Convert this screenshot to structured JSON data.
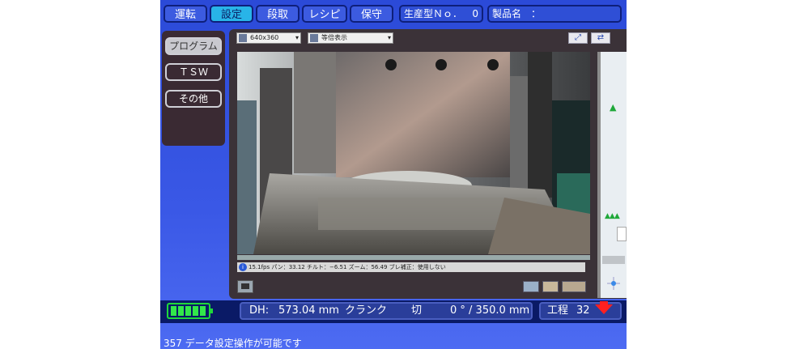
{
  "tabs": [
    {
      "label": "運転"
    },
    {
      "label": "設定"
    },
    {
      "label": "段取"
    },
    {
      "label": "レシピ"
    },
    {
      "label": "保守"
    }
  ],
  "header": {
    "model_no_label": "生産型Ｎｏ．",
    "model_no_value": "0",
    "product_name_label": "製品名　："
  },
  "side_menu": [
    {
      "label": "プログラム"
    },
    {
      "label": "ＴＳＷ"
    },
    {
      "label": "その他"
    }
  ],
  "viewer": {
    "resolution_select": "640x360",
    "display_mode_select": "等倍表示",
    "status_text": "15.1fps パン：33.12 チルト：−6.51 ズーム：56.49 ブレ補正：使用しない"
  },
  "bottom": {
    "battery_level": 1.0,
    "dh_label": "DH:",
    "dh_value": "573.04 mm",
    "crank_label": "クランク",
    "crank_state": "切",
    "angle_value": "0 ° / 350.0 mm",
    "process_label": "工程",
    "process_value": "32"
  },
  "message": "357 データ設定操作が可能です",
  "colors": {
    "tab_active": "#28b4e8",
    "accent_arrow": "#ff2020",
    "battery": "#32e84a"
  }
}
